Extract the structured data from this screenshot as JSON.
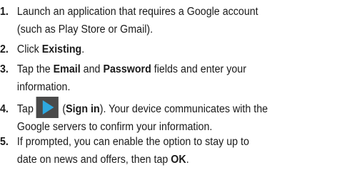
{
  "steps": [
    {
      "number": "1.",
      "line1": "Launch an application that requires a Google account",
      "line2": "(such as Play Store or Gmail)."
    },
    {
      "number": "2.",
      "pre": "Click ",
      "bold": "Existing",
      "post": "."
    },
    {
      "number": "3.",
      "pre": "Tap the ",
      "bold1": "Email",
      "mid": " and ",
      "bold2": "Password",
      "post": " fields and enter your",
      "line2": "information."
    },
    {
      "number": "4.",
      "pre": "Tap",
      "icon": "play-arrow-icon",
      "paren_open": "(",
      "bold": "Sign in",
      "paren_close": ")",
      "post": ". Your device communicates with the",
      "line2": "Google servers to confirm your information."
    },
    {
      "number": "5.",
      "line1": "If prompted, you can enable the option to stay up to",
      "line2_pre": "date on news and offers, then tap ",
      "line2_bold": "OK",
      "line2_post": "."
    }
  ],
  "colors": {
    "text": "#1a1a1a",
    "icon_background": "#4a4a4a",
    "icon_arrow": "#2ea8e0"
  }
}
